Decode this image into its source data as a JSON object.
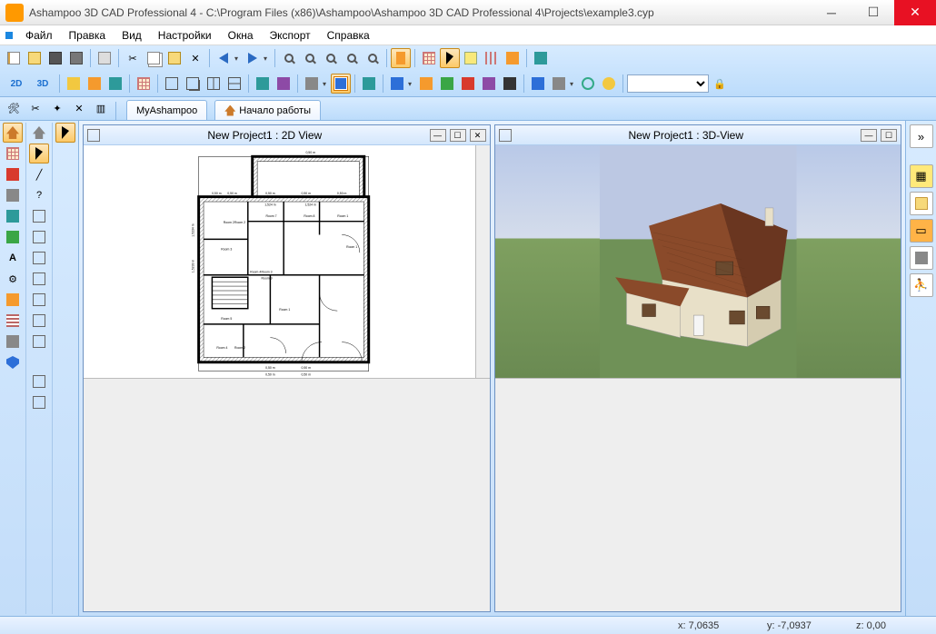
{
  "title": "Ashampoo 3D CAD Professional 4 - C:\\Program Files (x86)\\Ashampoo\\Ashampoo 3D CAD Professional 4\\Projects\\example3.cyp",
  "menu": {
    "items": [
      "Файл",
      "Правка",
      "Вид",
      "Настройки",
      "Окна",
      "Экспорт",
      "Справка"
    ]
  },
  "tabs": {
    "myashampoo": "MyAshampoo",
    "start": "Начало работы"
  },
  "views": {
    "left": {
      "title": "New Project1 : 2D View"
    },
    "right": {
      "title": "New Project1 : 3D-View"
    }
  },
  "plan": {
    "dims": [
      "0,50 m",
      "0,50 m",
      "0,50 m",
      "0,50 m",
      "0,50 m",
      "0,50 m",
      "0,50 m",
      "0,50 m",
      "0,50 m",
      "0,50 m"
    ],
    "side_dims": [
      "1,5233 m",
      "1,5234 m",
      "0,50 m"
    ],
    "room_dims": [
      "1,524 m",
      "1,524 m"
    ],
    "rooms": [
      "Room 1",
      "Room 1",
      "Room 1",
      "Room 2",
      "Room 2",
      "Room 2",
      "Room 3",
      "Room 3",
      "Room 4",
      "Room 4",
      "Room 5",
      "Room 7",
      "Room 8",
      "Room 9"
    ]
  },
  "status": {
    "x": "x: 7,0635",
    "y": "y: -7,0937",
    "z": "z: 0,00"
  },
  "toolbar2_labels": {
    "btn2d": "2D",
    "btn3d": "3D"
  }
}
